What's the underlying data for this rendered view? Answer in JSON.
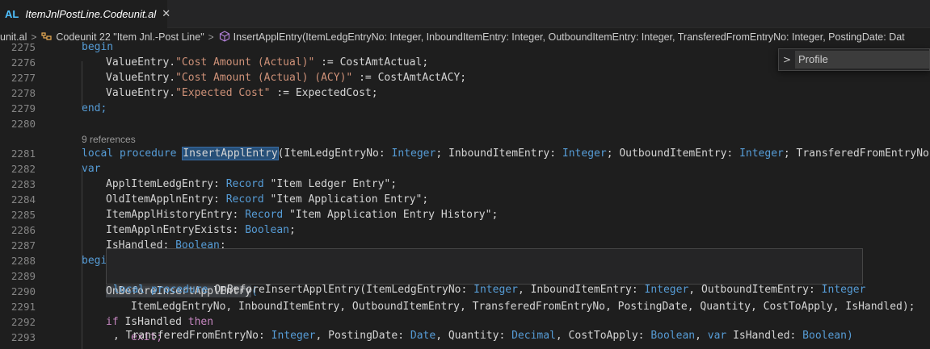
{
  "tab": {
    "lang": "AL",
    "title": "ItemJnlPostLine.Codeunit.al",
    "close_glyph": "✕"
  },
  "breadcrumb": {
    "file": "unit.al",
    "codeunit": "Codeunit 22 \"Item Jnl.-Post Line\"",
    "symbol": "InsertApplEntry(ItemLedgEntryNo: Integer, InboundItemEntry: Integer, OutboundItemEntry: Integer, TransferedFromEntryNo: Integer, PostingDate: Dat"
  },
  "profile_widget": {
    "value": "Profile"
  },
  "codelens": "9 references",
  "line_numbers": [
    "2275",
    "2276",
    "2277",
    "2278",
    "2279",
    "2280",
    "2281",
    "2282",
    "2283",
    "2284",
    "2285",
    "2286",
    "2287",
    "2288",
    "2289",
    "2290",
    "2291",
    "2292",
    "2293"
  ],
  "code": {
    "l2275": "begin",
    "l2276": [
      "ValueEntry.",
      "\"Cost Amount (Actual)\"",
      " := ",
      "CostAmtActual;"
    ],
    "l2277": [
      "ValueEntry.",
      "\"Cost Amount (Actual) (ACY)\"",
      " := ",
      "CostAmtActACY;"
    ],
    "l2278": [
      "ValueEntry.",
      "\"Expected Cost\"",
      " := ",
      "ExpectedCost;"
    ],
    "l2279": "end;",
    "l2281": [
      "local",
      "procedure",
      "InsertApplEntry",
      "(ItemLedgEntryNo: ",
      "Integer",
      "; InboundItemEntry: ",
      "Integer",
      "; OutboundItemEntry: ",
      "Integer",
      "; TransferedFromEntryNo: ",
      "I"
    ],
    "l2282": "var",
    "l2283": [
      "ApplItemLedgEntry: ",
      "Record",
      " ",
      "\"Item Ledger Entry\"",
      ";"
    ],
    "l2284": [
      "OldItemApplnEntry: ",
      "Record",
      " ",
      "\"Item Application Entry\"",
      ";"
    ],
    "l2285": [
      "ItemApplHistoryEntry: ",
      "Record",
      " ",
      "\"Item Application Entry History\"",
      ";"
    ],
    "l2286": [
      "ItemApplnEntryExists: ",
      "Boolean",
      ";"
    ],
    "l2287": [
      "IsHandled: ",
      "Boolean",
      ";"
    ],
    "l2288": "begi",
    "l2290": [
      "OnBeforeInsertApplEntry",
      "("
    ],
    "l2291": "ItemLedgEntryNo, InboundItemEntry, OutboundItemEntry, TransferedFromEntryNo, PostingDate, Quantity, CostToApply, IsHandled);",
    "l2292": [
      "if",
      " IsHandled ",
      "then"
    ],
    "l2293": "exit;"
  },
  "hover": {
    "line1": [
      "local",
      "procedure",
      "OnBeforeInsertApplEntry(ItemLedgEntryNo: ",
      "Integer",
      ", InboundItemEntry: ",
      "Integer",
      ", OutboundItemEntry: ",
      "Integer"
    ],
    "line2": [
      ", TransferedFromEntryNo: ",
      "Integer",
      ", PostingDate: ",
      "Date",
      ", Quantity: ",
      "Decimal",
      ", CostToApply: ",
      "Boolean",
      ", ",
      "var",
      " IsHandled: ",
      "Boolean",
      ")"
    ]
  },
  "colors": {
    "keyword": "#569cd6",
    "control": "#c586c0",
    "string": "#ce9178",
    "type": "#4fc1ff",
    "background": "#1e1e1e"
  }
}
